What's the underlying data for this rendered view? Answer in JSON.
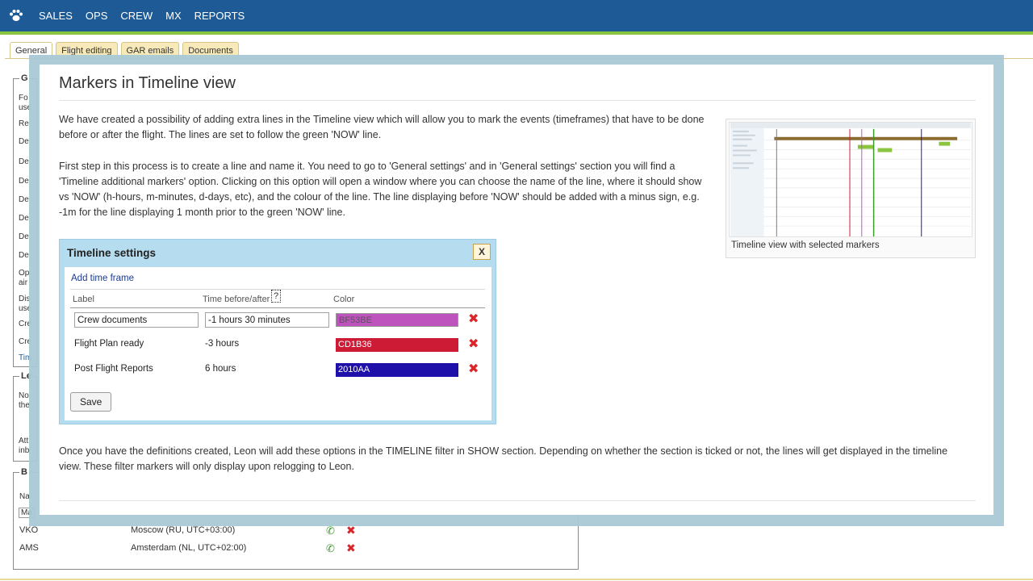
{
  "nav": {
    "items": [
      "SALES",
      "OPS",
      "CREW",
      "MX",
      "REPORTS"
    ]
  },
  "tabs": [
    "General",
    "Flight editing",
    "GAR emails",
    "Documents"
  ],
  "background": {
    "legend_stubs": [
      "G",
      "Le",
      "B"
    ],
    "side_stubs": [
      "Fo",
      "use",
      "Re",
      "De",
      "De",
      "De",
      "De",
      "De",
      "De",
      "De",
      "Op",
      "air",
      "Dis",
      "use",
      "Cre",
      "Cre",
      "Tim",
      "No",
      "the",
      "Att",
      "inb",
      "Na",
      "Ma"
    ],
    "rows": [
      {
        "code": "VKO",
        "city": "Moscow (RU, UTC+03:00)"
      },
      {
        "code": "AMS",
        "city": "Amsterdam (NL, UTC+02:00)"
      }
    ]
  },
  "modal": {
    "title": "Markers in Timeline view",
    "para1": "We have created a possibility of adding extra lines in the Timeline view which will allow you to mark the events (timeframes) that have to be done before or after the flight. The lines are set to follow the green 'NOW' line.",
    "para2": "First step in this process is to create a line and name it. You need to go to 'General settings' and in 'General settings' section you will find a 'Timeline additional markers' option. Clicking on this option will open a window where you can choose the name of the line, where it should show vs 'NOW' (h-hours, m-minutes, d-days, etc), and the colour of the line. The line displaying before 'NOW' should be added with a minus sign, e.g. -1m for the line displaying 1 month prior to the green 'NOW' line.",
    "para3": "Once you have the definitions created, Leon will add these options in the TIMELINE filter in SHOW section. Depending on whether the section is ticked or not, the lines will get displayed in the timeline view. These filter markers will only display upon relogging to Leon.",
    "thumb_caption": "Timeline view with selected markers"
  },
  "timeline_settings": {
    "title": "Timeline settings",
    "close_label": "X",
    "add_label": "Add time frame",
    "headers": {
      "label": "Label",
      "time": "Time before/after",
      "help": "?",
      "color": "Color"
    },
    "rows": [
      {
        "label": "Crew documents",
        "time": "-1 hours 30 minutes",
        "color": "BF53BE",
        "hex": "#bf53be"
      },
      {
        "label": "Flight Plan ready",
        "time": "-3 hours",
        "color": "CD1B36",
        "hex": "#cd1b36"
      },
      {
        "label": "Post Flight Reports",
        "time": "6 hours",
        "color": "2010AA",
        "hex": "#2010aa"
      }
    ],
    "save_label": "Save"
  },
  "colors": {
    "nav_bg": "#1e5b96",
    "nav_accent": "#8bc43f",
    "overlay": "#a9c9d6",
    "dialog": "#b6dcef",
    "delete": "#d9262b"
  },
  "icons": {
    "logo": "paw-icon",
    "delete": "red-x-icon",
    "phone": "phone-icon"
  }
}
